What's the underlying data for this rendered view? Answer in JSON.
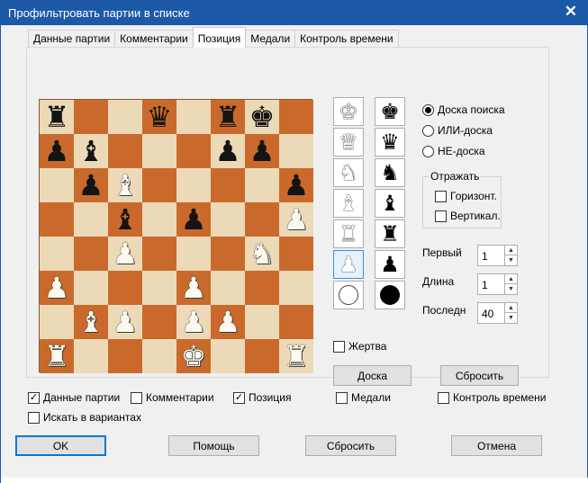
{
  "window": {
    "title": "Профильтровать партии в списке"
  },
  "tabs": [
    "Данные партии",
    "Комментарии",
    "Позиция",
    "Медали",
    "Контроль времени"
  ],
  "active_tab": "Позиция",
  "board": {
    "rows": [
      [
        "r",
        "",
        "",
        "q",
        "",
        "r",
        "k",
        ""
      ],
      [
        "p",
        "b",
        "",
        "",
        "",
        "p",
        "p",
        ""
      ],
      [
        "",
        "p",
        "B",
        "",
        "",
        "",
        "",
        "p"
      ],
      [
        "",
        "",
        "b",
        "",
        "p",
        "",
        "",
        "P"
      ],
      [
        "",
        "",
        "P",
        "",
        "",
        "",
        "N",
        ""
      ],
      [
        "P",
        "",
        "",
        "",
        "P",
        "",
        "",
        ""
      ],
      [
        "",
        "B",
        "P",
        "",
        "P",
        "P",
        "",
        ""
      ],
      [
        "R",
        "",
        "",
        "",
        "K",
        "",
        "",
        "R"
      ]
    ]
  },
  "palette": {
    "white": [
      "K",
      "Q",
      "N",
      "B",
      "R",
      "P",
      "disc"
    ],
    "black": [
      "k",
      "q",
      "n",
      "b",
      "r",
      "p",
      "disc"
    ],
    "selected": "P"
  },
  "board_mode": {
    "options": [
      "Доска поиска",
      "ИЛИ-доска",
      "НЕ-доска"
    ],
    "selected": 0
  },
  "reflect": {
    "label": "Отражать",
    "horizontal": {
      "label": "Горизонт.",
      "checked": false
    },
    "vertical": {
      "label": "Вертикал.",
      "checked": false
    }
  },
  "spinners": [
    {
      "label": "Первый",
      "value": "1"
    },
    {
      "label": "Длина",
      "value": "1"
    },
    {
      "label": "Последний",
      "value": "40"
    }
  ],
  "sacrifice": {
    "label": "Жертва",
    "checked": false
  },
  "board_button": "Доска",
  "reset_board_button": "Сбросить",
  "filters": [
    {
      "label": "Данные партии",
      "checked": true
    },
    {
      "label": "Комментарии",
      "checked": false
    },
    {
      "label": "Позиция",
      "checked": true
    },
    {
      "label": "Медали",
      "checked": false
    },
    {
      "label": "Контроль времени",
      "checked": false
    },
    {
      "label": "Искать в вариантах",
      "checked": false
    }
  ],
  "buttons": {
    "ok": "OK",
    "help": "Помощь",
    "reset": "Сбросить",
    "cancel": "Отмена"
  },
  "colors": {
    "titlebar": "#1c5aa8",
    "light_square": "#ecd9b8",
    "dark_square": "#c96a2c",
    "default_button_border": "#0078d7"
  }
}
